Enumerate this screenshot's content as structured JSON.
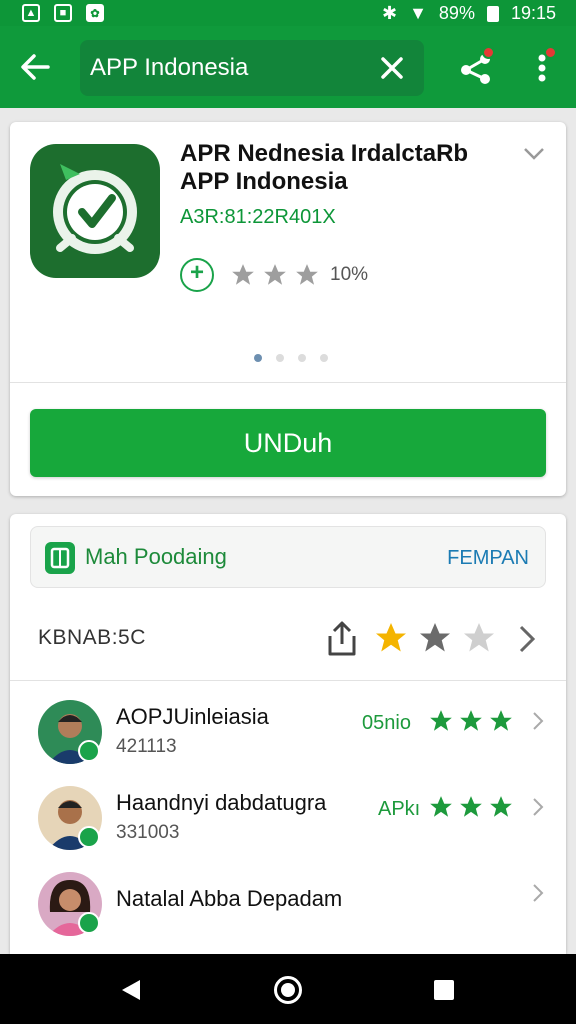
{
  "status_bar": {
    "battery": "89%",
    "time": "19:15"
  },
  "search": {
    "value": "APP Indonesia",
    "placeholder": ""
  },
  "app": {
    "title": "APR Nednesia  IrdalctaRb",
    "subtitle": "APP Indonesia",
    "code": "A3R:81:22R401X",
    "rating_percent": "10%",
    "rating_stars": 3,
    "install_label": "UNDuh",
    "carousel": {
      "pages": 4,
      "active": 0
    }
  },
  "promo": {
    "label": "Mah Poodaing",
    "action": "FEMPAN"
  },
  "section": {
    "label": "KBNAB:5C",
    "stars_filled": 1,
    "stars_total": 3
  },
  "reviews": [
    {
      "name": "AOPJUinleiasia",
      "sub": "421113",
      "tag": "05nio",
      "stars": 3,
      "avatar_bg": "#2e8b57"
    },
    {
      "name": "Haandnyi dabdatugra",
      "sub": "331003",
      "tag": "APkı",
      "stars": 3,
      "avatar_bg": "#e6d5b8"
    },
    {
      "name": "Natalal Abba Depadam",
      "sub": "",
      "tag": "",
      "stars": 0,
      "avatar_bg": "#d9a9c4"
    }
  ],
  "colors": {
    "brand_green": "#0f9a3b",
    "install_green": "#17a83b",
    "star_gray": "#9e9e9e",
    "star_gold": "#f4b400",
    "link_blue": "#1b7bb3"
  },
  "icons": {
    "status": [
      "image-icon",
      "document-icon",
      "photo-icon",
      "bluetooth-icon",
      "wifi-icon",
      "battery-icon"
    ],
    "appbar": [
      "back-arrow-icon",
      "clear-icon",
      "share-icon",
      "more-vert-icon"
    ]
  }
}
